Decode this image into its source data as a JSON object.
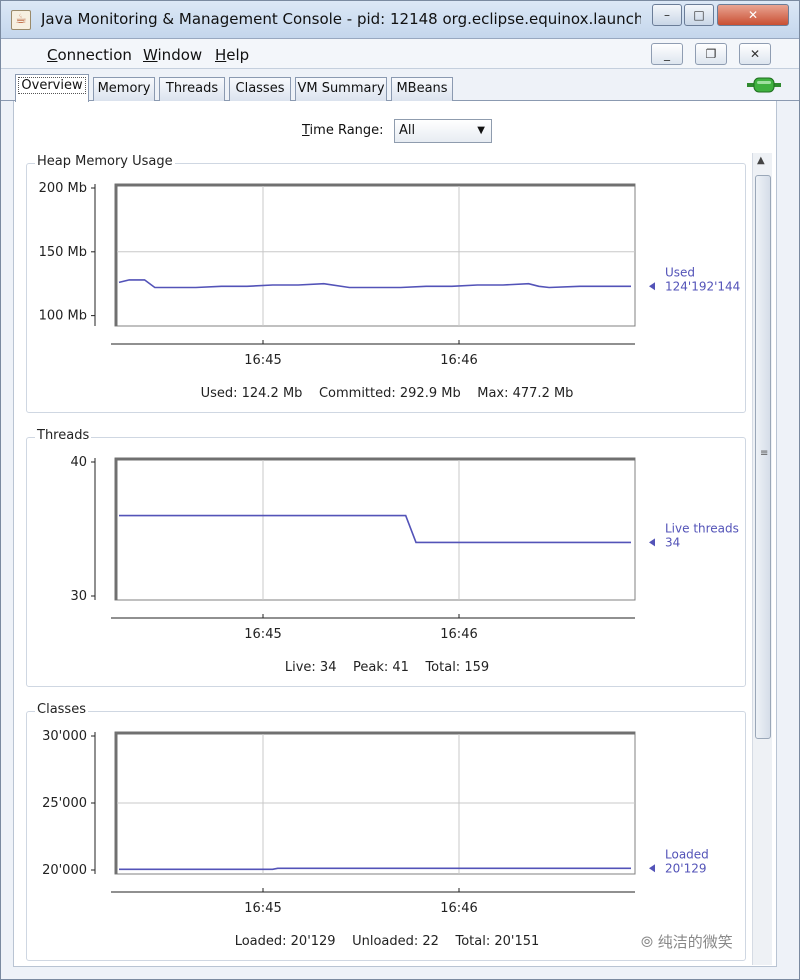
{
  "window": {
    "title": "Java Monitoring & Management Console - pid: 12148 org.eclipse.equinox.launch...",
    "controls": {
      "minimize": "–",
      "maximize": "□",
      "close": "✕"
    }
  },
  "menu": [
    {
      "label": "Connection",
      "mnemonic": "C",
      "rest": "onnection"
    },
    {
      "label": "Window",
      "mnemonic": "W",
      "rest": "indow"
    },
    {
      "label": "Help",
      "mnemonic": "H",
      "rest": "elp"
    }
  ],
  "mdi": {
    "minimize": "_",
    "restore": "❐",
    "close": "✕"
  },
  "tabs": [
    "Overview",
    "Memory",
    "Threads",
    "Classes",
    "VM Summary",
    "MBeans"
  ],
  "active_tab": "Overview",
  "time_range": {
    "label_mn": "T",
    "label_rest": "ime Range:",
    "value": "All"
  },
  "colors": {
    "series": "#5353b8",
    "grid": "#c8c8c8",
    "frame": "#808080"
  },
  "chart_data": [
    {
      "type": "line",
      "title": "Heap Memory Usage",
      "y_ticks": [
        "200 Mb",
        "150 Mb",
        "100 Mb"
      ],
      "y_tick_values": [
        200,
        150,
        100
      ],
      "ylim": [
        95,
        200
      ],
      "x_ticks": [
        "16:45",
        "16:46"
      ],
      "series": [
        {
          "name": "Used",
          "value_label": "124'192'144",
          "x": [
            0,
            0.02,
            0.05,
            0.07,
            0.1,
            0.15,
            0.2,
            0.25,
            0.3,
            0.35,
            0.4,
            0.45,
            0.5,
            0.55,
            0.6,
            0.65,
            0.7,
            0.75,
            0.8,
            0.82,
            0.84,
            0.9,
            0.95,
            1.0
          ],
          "y": [
            126,
            128,
            128,
            122,
            122,
            122,
            123,
            123,
            124,
            124,
            125,
            122,
            122,
            122,
            123,
            123,
            124,
            124,
            125,
            123,
            122,
            123,
            123,
            123
          ]
        }
      ],
      "summary": "Used: 124.2 Mb    Committed: 292.9 Mb    Max: 477.2 Mb"
    },
    {
      "type": "line",
      "title": "Threads",
      "y_ticks": [
        "40",
        "30"
      ],
      "y_tick_values": [
        40,
        30
      ],
      "ylim": [
        30,
        40
      ],
      "x_ticks": [
        "16:45",
        "16:46"
      ],
      "series": [
        {
          "name": "Live threads",
          "value_label": "34",
          "x": [
            0,
            0.56,
            0.58,
            1.0
          ],
          "y": [
            36,
            36,
            34,
            34
          ]
        }
      ],
      "summary": "Live: 34    Peak: 41    Total: 159"
    },
    {
      "type": "line",
      "title": "Classes",
      "y_ticks": [
        "30'000",
        "25'000",
        "20'000"
      ],
      "y_tick_values": [
        30000,
        25000,
        20000
      ],
      "ylim": [
        20000,
        30000
      ],
      "x_ticks": [
        "16:45",
        "16:46"
      ],
      "series": [
        {
          "name": "Loaded",
          "value_label": "20'129",
          "x": [
            0,
            0.3,
            0.31,
            1.0
          ],
          "y": [
            20050,
            20050,
            20129,
            20129
          ]
        }
      ],
      "summary": "Loaded: 20'129    Unloaded: 22    Total: 20'151"
    }
  ],
  "watermark": "纯洁的微笑"
}
